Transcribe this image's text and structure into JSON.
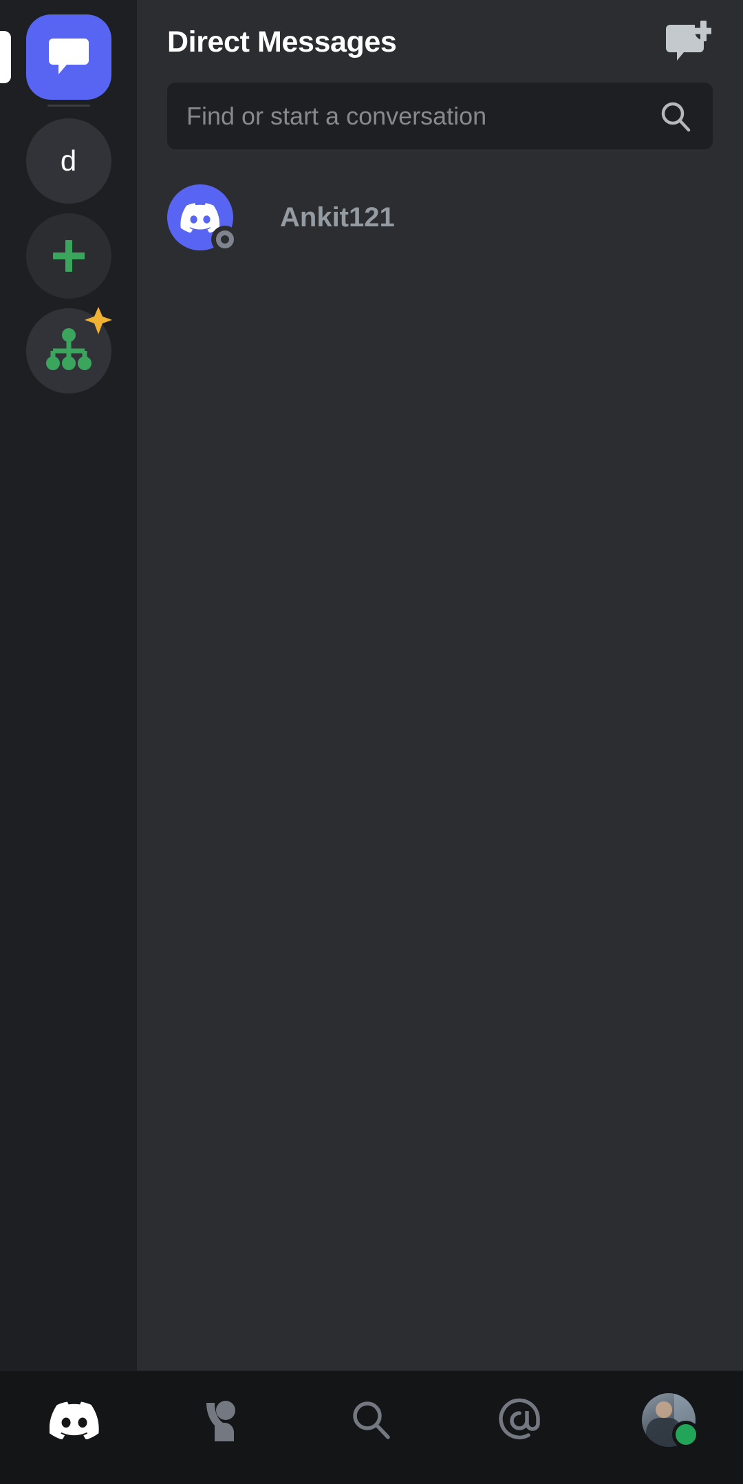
{
  "app": {
    "name": "Discord",
    "theme": "dark"
  },
  "colors": {
    "brand_blurple": "#5865f2",
    "sidebar_bg": "#1e1f22",
    "panel_bg": "#2b2d31",
    "nav_bg": "#141517",
    "search_bg": "#1e1f22",
    "green_accent": "#3ba55d",
    "star_yellow": "#f0b232",
    "online_green": "#23a559",
    "offline_gray": "#80848e",
    "text_primary": "#ffffff",
    "text_muted": "#959ba3",
    "placeholder": "#87898c"
  },
  "guild_sidebar": {
    "active_indicator": "active-pill",
    "items": [
      {
        "id": "direct-messages",
        "type": "dm-home",
        "label": "Direct Messages",
        "icon": "chat-bubble-icon",
        "active": true
      },
      {
        "id": "server-d",
        "type": "server",
        "label": "d",
        "icon": "server-letter-icon",
        "active": false
      },
      {
        "id": "add-server",
        "type": "action",
        "label": "+",
        "icon": "plus-icon",
        "active": false
      },
      {
        "id": "explore-servers",
        "type": "action",
        "label": "Explore Public Servers",
        "icon": "explore-hierarchy-icon",
        "badge": "star-badge",
        "active": false
      }
    ]
  },
  "header": {
    "title": "Direct Messages",
    "new_dm_icon": "new-message-icon"
  },
  "search": {
    "placeholder": "Find or start a conversation",
    "value": "",
    "icon": "search-icon"
  },
  "dm_list": {
    "items": [
      {
        "name": "Ankit121",
        "avatar_icon": "discord-logo-avatar",
        "avatar_color": "#5865f2",
        "status": "offline",
        "status_icon": "offline-status-icon"
      }
    ]
  },
  "bottom_nav": {
    "items": [
      {
        "id": "servers",
        "label": "Servers",
        "icon": "discord-logo-icon",
        "active": true
      },
      {
        "id": "friends",
        "label": "Friends",
        "icon": "person-icon",
        "active": false
      },
      {
        "id": "search",
        "label": "Search",
        "icon": "search-icon",
        "active": false
      },
      {
        "id": "mentions",
        "label": "Mentions",
        "icon": "at-mention-icon",
        "active": false
      },
      {
        "id": "profile",
        "label": "You",
        "icon": "user-avatar-icon",
        "active": false,
        "presence": "online"
      }
    ]
  }
}
